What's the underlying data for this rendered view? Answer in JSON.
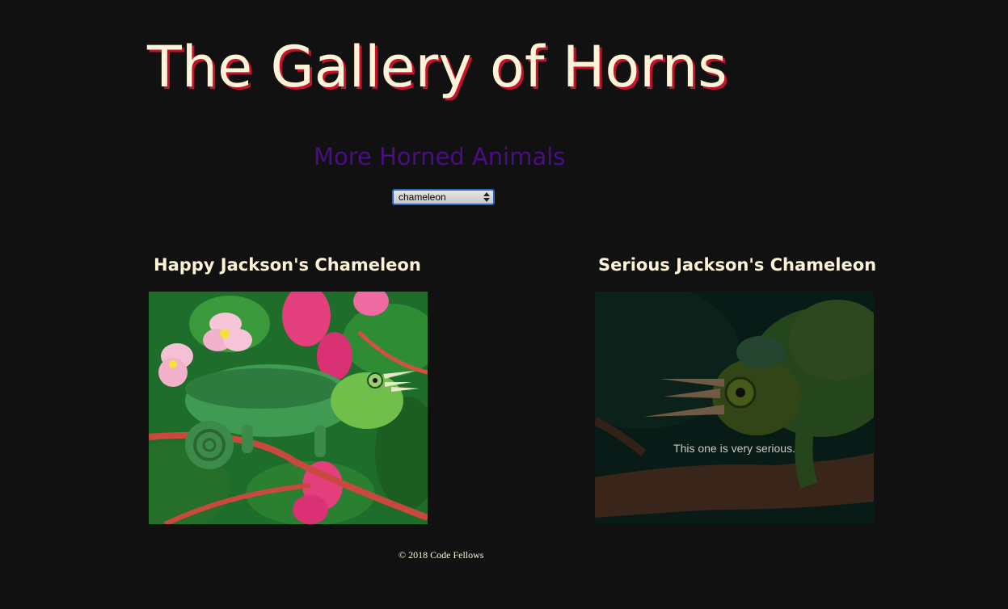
{
  "header": {
    "title": "The Gallery of Horns"
  },
  "filter": {
    "heading": "More Horned Animals",
    "selected": "chameleon"
  },
  "gallery": [
    {
      "title": "Happy Jackson's Chameleon",
      "caption": ""
    },
    {
      "title": "Serious Jackson's Chameleon",
      "caption": "This one is very serious."
    }
  ],
  "footer": {
    "text": "© 2018 Code Fellows"
  },
  "colors": {
    "background": "#111111",
    "title": "#fdf3d6",
    "title_shadow": "#c8102e",
    "heading": "#4b0d86",
    "select_border": "#2a67c0"
  }
}
